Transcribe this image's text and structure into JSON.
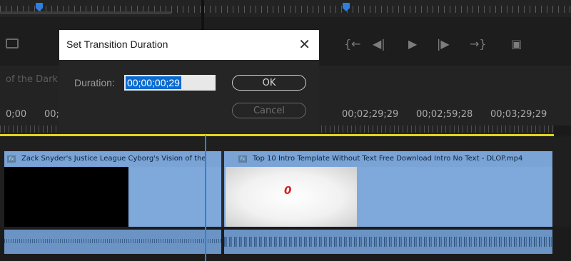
{
  "dialog": {
    "title": "Set Transition Duration",
    "close_glyph": "✕",
    "duration_label": "Duration:",
    "duration_value": "00;00;00;29",
    "ok_label": "OK",
    "cancel_label": "Cancel"
  },
  "timeline": {
    "sequence_name": "of the Dark",
    "timecodes": [
      "0;00",
      "00;",
      "00;02;29;29",
      "00;02;59;28",
      "00;03;29;29"
    ],
    "clips": [
      {
        "title": "Zack Snyder's Justice League  Cyborg's Vision of the",
        "fx": "fx"
      },
      {
        "title": "Top 10 Intro Template Without Text Free Download Intro No Text - DLOP.mp4",
        "fx": "fx"
      }
    ],
    "thumbnail_glyph": "0"
  },
  "transport": {
    "icons": [
      "mark-in-icon",
      "step-back-icon",
      "play-icon",
      "step-forward-icon",
      "mark-out-icon",
      "export-frame-icon"
    ],
    "glyphs": [
      "{←",
      "◀|",
      "▶",
      "|▶",
      "→}",
      "▣"
    ]
  },
  "colors": {
    "accent": "#2f7fe0",
    "clip": "#7fa8db",
    "work_bar": "#e3d61a",
    "selection": "#0a6bd1"
  }
}
